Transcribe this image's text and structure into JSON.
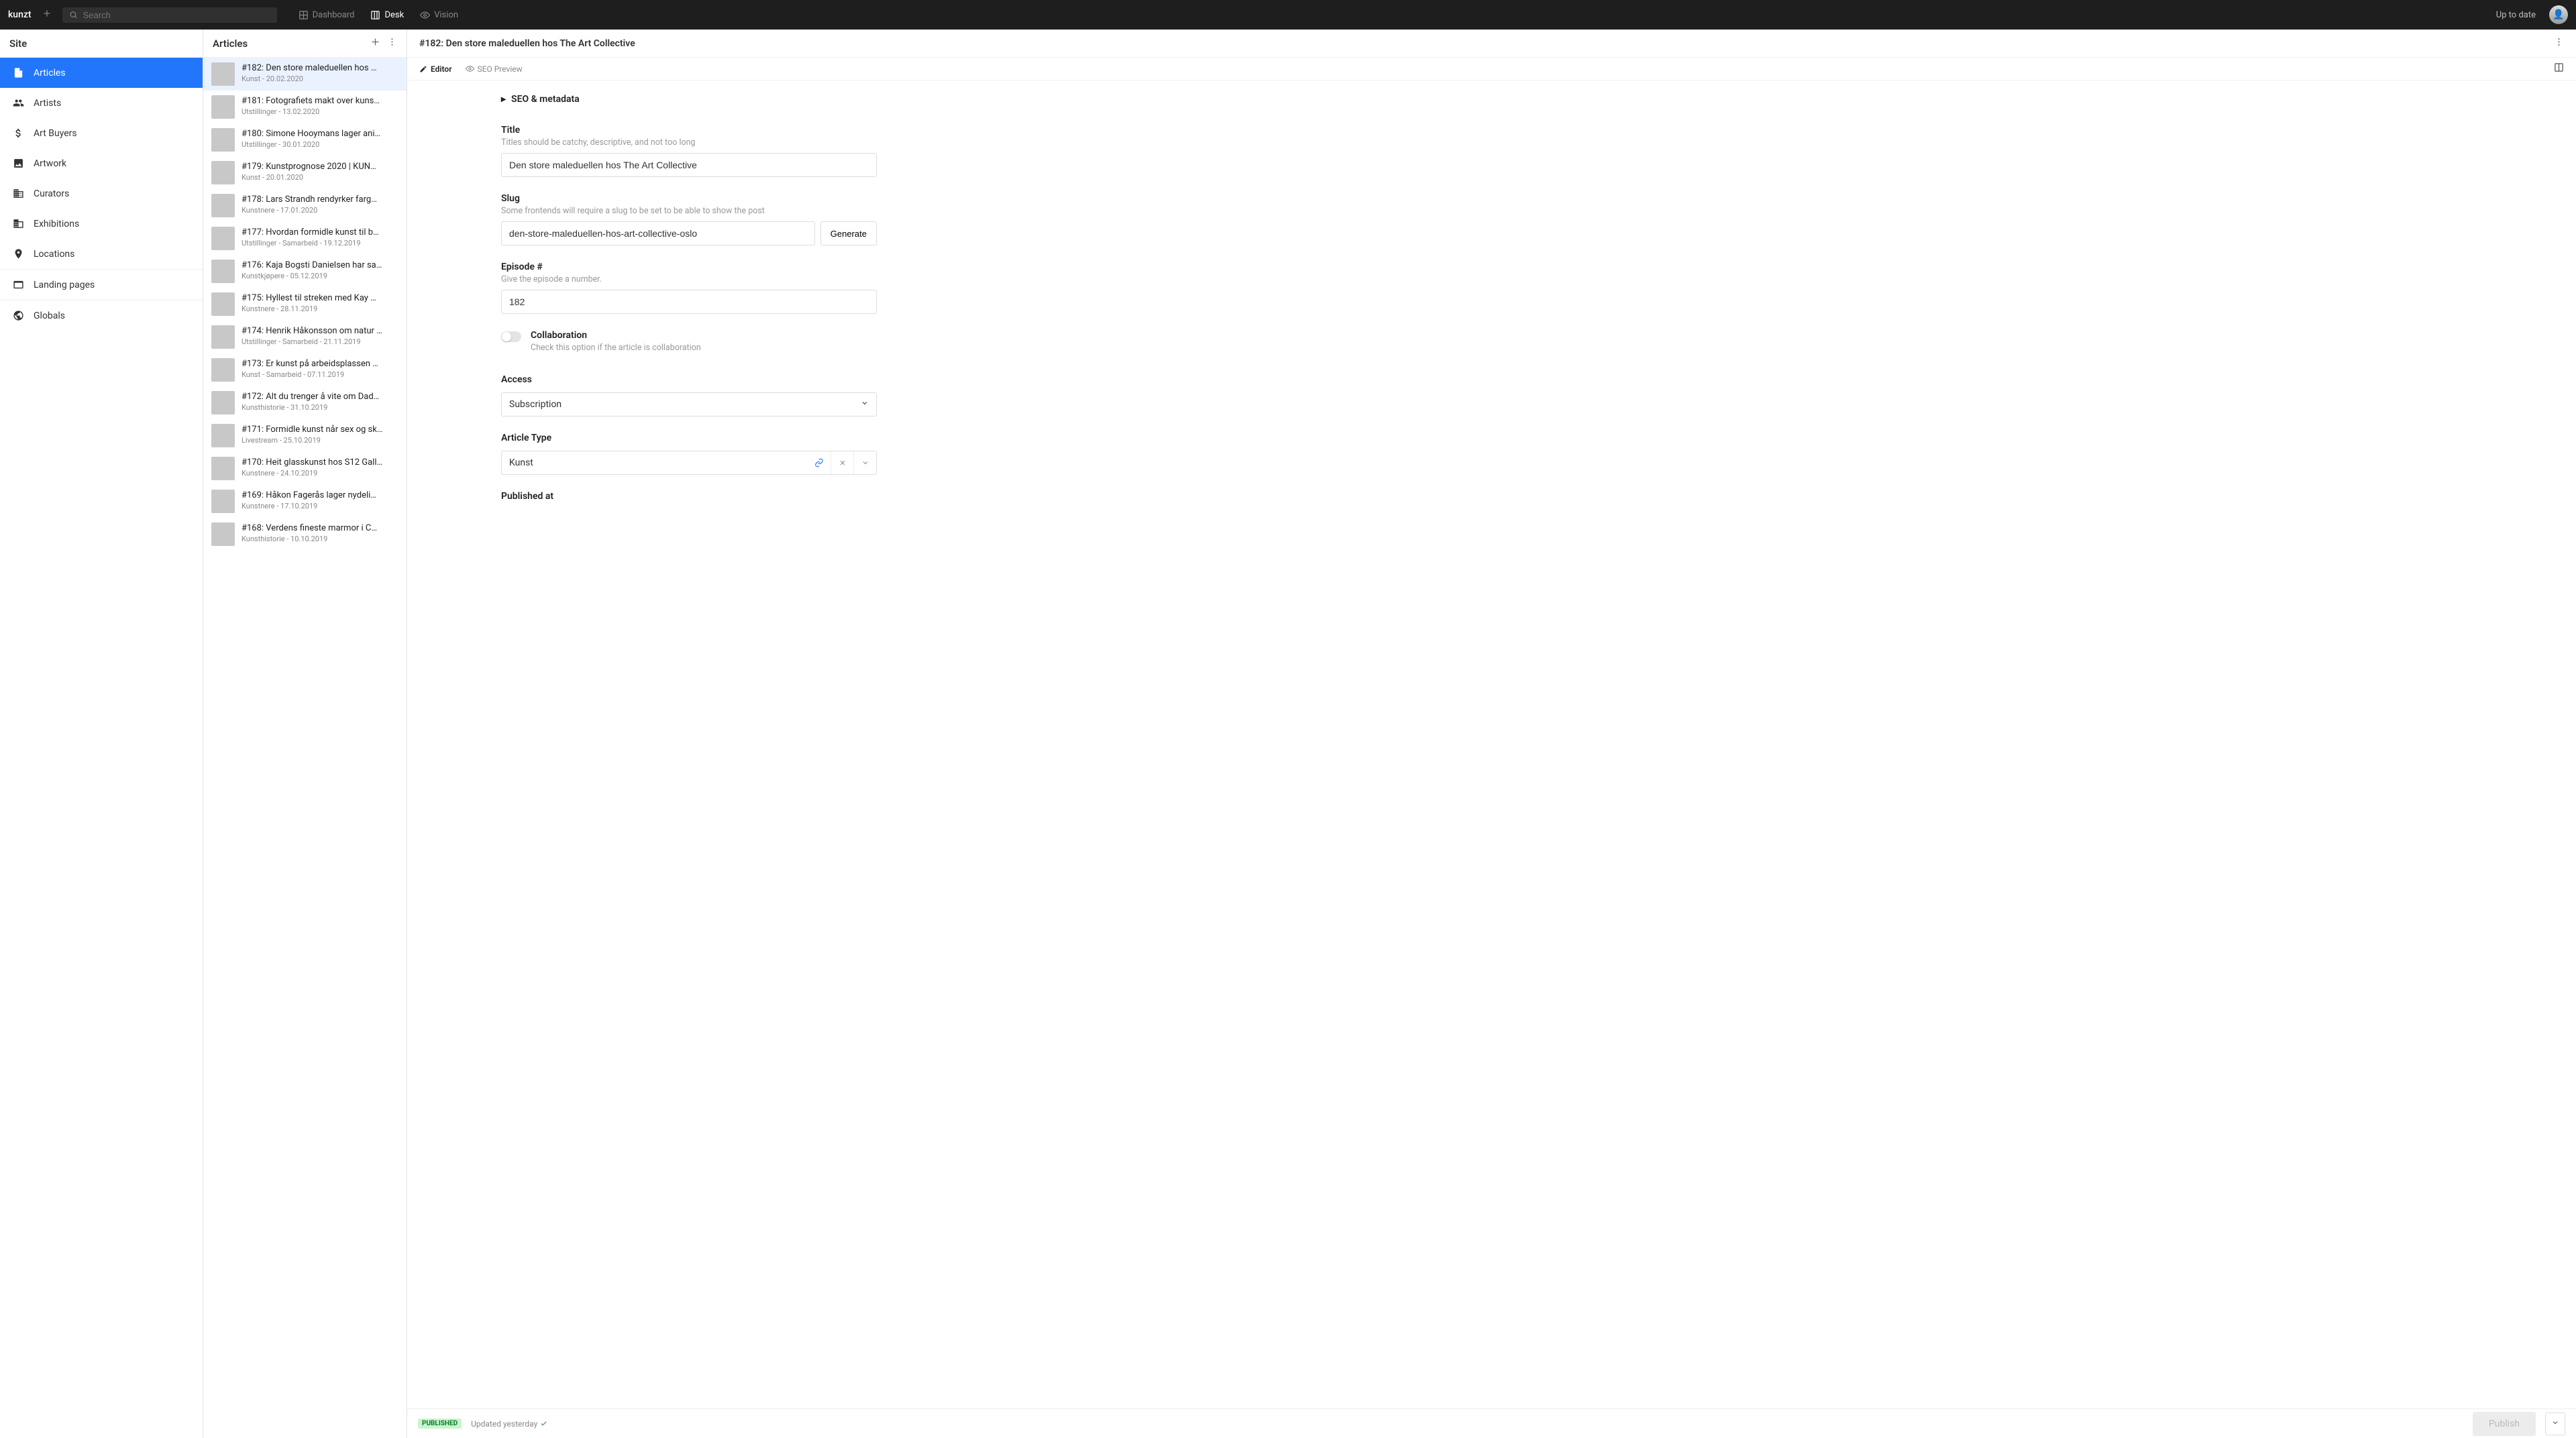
{
  "topbar": {
    "brand": "kunzt",
    "search_placeholder": "Search",
    "nav": [
      {
        "label": "Dashboard",
        "active": false
      },
      {
        "label": "Desk",
        "active": true
      },
      {
        "label": "Vision",
        "active": false
      }
    ],
    "status": "Up to date"
  },
  "site_panel": {
    "title": "Site",
    "items": [
      {
        "label": "Articles",
        "name": "articles",
        "selected": true
      },
      {
        "label": "Artists",
        "name": "artists"
      },
      {
        "label": "Art Buyers",
        "name": "art-buyers"
      },
      {
        "label": "Artwork",
        "name": "artwork"
      },
      {
        "label": "Curators",
        "name": "curators"
      },
      {
        "label": "Exhibitions",
        "name": "exhibitions"
      },
      {
        "label": "Locations",
        "name": "locations"
      }
    ],
    "group2": [
      {
        "label": "Landing pages",
        "name": "landing-pages"
      }
    ],
    "group3": [
      {
        "label": "Globals",
        "name": "globals"
      }
    ]
  },
  "articles_panel": {
    "title": "Articles",
    "items": [
      {
        "title": "#182: Den store maleduellen hos …",
        "meta": "Kunst - 20.02.2020",
        "selected": true
      },
      {
        "title": "#181: Fotografiets makt over kuns…",
        "meta": "Utstillinger - 13.02.2020"
      },
      {
        "title": "#180: Simone Hooymans lager ani…",
        "meta": "Utstillinger - 30.01.2020"
      },
      {
        "title": "#179: Kunstprognose 2020 | KUN…",
        "meta": "Kunst - 20.01.2020"
      },
      {
        "title": "#178: Lars Strandh rendyrker farg…",
        "meta": "Kunstnere - 17.01.2020"
      },
      {
        "title": "#177: Hvordan formidle kunst til b…",
        "meta": "Utstillinger - Samarbeid - 19.12.2019"
      },
      {
        "title": "#176: Kaja Bogsti Danielsen har sa…",
        "meta": "Kunstkjøpere - 05.12.2019"
      },
      {
        "title": "#175: Hyllest til streken med Kay …",
        "meta": "Kunstnere - 28.11.2019"
      },
      {
        "title": "#174: Henrik Håkonsson om natur …",
        "meta": "Utstillinger - Samarbeid - 21.11.2019"
      },
      {
        "title": "#173: Er kunst på arbeidsplassen …",
        "meta": "Kunst - Samarbeid - 07.11.2019"
      },
      {
        "title": "#172: Alt du trenger å vite om Dad…",
        "meta": "Kunsthistorie - 31.10.2019"
      },
      {
        "title": "#171: Formidle kunst når sex og sk…",
        "meta": "Livestream - 25.10.2019"
      },
      {
        "title": "#170: Heit glasskunst hos S12 Gall…",
        "meta": "Kunstnere - 24.10.2019"
      },
      {
        "title": "#169: Håkon Fagerås lager nydeli…",
        "meta": "Kunstnere - 17.10.2019"
      },
      {
        "title": "#168: Verdens fineste marmor i C…",
        "meta": "Kunsthistorie - 10.10.2019"
      }
    ]
  },
  "editor": {
    "doc_title": "#182: Den store maleduellen hos The Art Collective",
    "tabs": {
      "editor": "Editor",
      "seo_preview": "SEO Preview"
    },
    "seo_section": "SEO & metadata",
    "title_label": "Title",
    "title_help": "Titles should be catchy, descriptive, and not too long",
    "title_value": "Den store maleduellen hos The Art Collective",
    "slug_label": "Slug",
    "slug_help": "Some frontends will require a slug to be set to be able to show the post",
    "slug_value": "den-store-maleduellen-hos-art-collective-oslo",
    "generate": "Generate",
    "episode_label": "Episode #",
    "episode_help": "Give the episode a number.",
    "episode_value": "182",
    "collab_label": "Collaboration",
    "collab_help": "Check this option if the article is collaboration",
    "access_label": "Access",
    "access_value": "Subscription",
    "type_label": "Article Type",
    "type_value": "Kunst",
    "published_at": "Published at"
  },
  "footer": {
    "badge": "PUBLISHED",
    "updated": "Updated yesterday",
    "publish": "Publish"
  }
}
